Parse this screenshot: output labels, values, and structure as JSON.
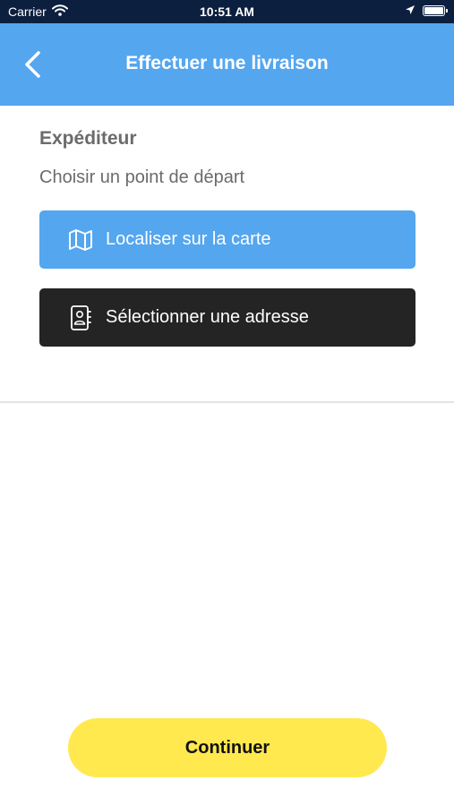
{
  "status_bar": {
    "carrier": "Carrier",
    "time": "10:51 AM"
  },
  "header": {
    "title": "Effectuer une livraison",
    "background_color": "#54a6ef"
  },
  "sender": {
    "title": "Expéditeur",
    "subtitle": "Choisir un point de départ",
    "locate_on_map_label": "Localiser sur la carte",
    "select_address_label": "Sélectionner une adresse"
  },
  "footer": {
    "continue_label": "Continuer",
    "button_color": "#ffe94f"
  },
  "icons": {
    "back": "chevron-left-icon",
    "map": "map-icon",
    "address_book": "address-book-icon"
  }
}
